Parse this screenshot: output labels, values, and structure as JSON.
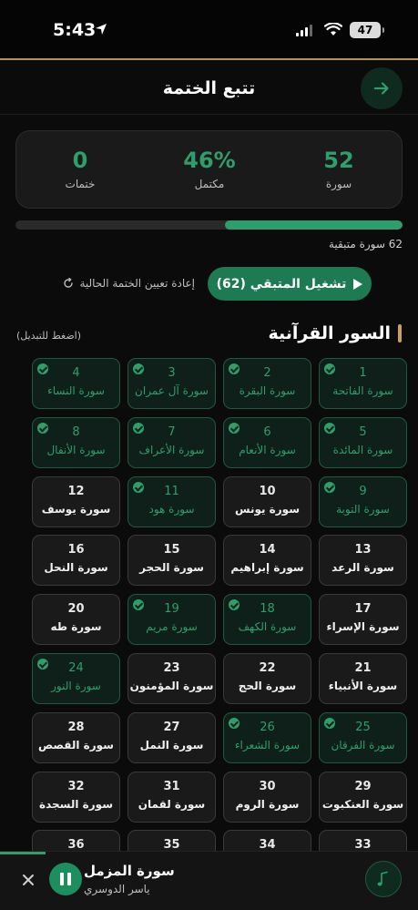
{
  "status_bar": {
    "time": "5:43",
    "battery": "47"
  },
  "header": {
    "title": "تتبع الختمة"
  },
  "stats": [
    {
      "value": "52",
      "label": "سورة"
    },
    {
      "value": "46%",
      "label": "مكتمل"
    },
    {
      "value": "0",
      "label": "ختمات"
    }
  ],
  "progress": {
    "fraction": 0.46,
    "remaining_text": "62 سورة متبقية"
  },
  "actions": {
    "play_label": "تشغيل المتبقي (62)",
    "reset_label": "إعادة تعيين الختمة الحالية"
  },
  "section": {
    "title": "السور القرآنية",
    "hint": "(اضغط للتبديل)"
  },
  "surahs": [
    {
      "num": "1",
      "name": "سورة الفاتحة",
      "done": true
    },
    {
      "num": "2",
      "name": "سورة البقرة",
      "done": true
    },
    {
      "num": "3",
      "name": "سورة آل عمران",
      "done": true
    },
    {
      "num": "4",
      "name": "سورة النساء",
      "done": true
    },
    {
      "num": "5",
      "name": "سورة المائدة",
      "done": true
    },
    {
      "num": "6",
      "name": "سورة الأنعام",
      "done": true
    },
    {
      "num": "7",
      "name": "سورة الأعراف",
      "done": true
    },
    {
      "num": "8",
      "name": "سورة الأنفال",
      "done": true
    },
    {
      "num": "9",
      "name": "سورة التوبة",
      "done": true
    },
    {
      "num": "10",
      "name": "سورة يونس",
      "done": false
    },
    {
      "num": "11",
      "name": "سورة هود",
      "done": true
    },
    {
      "num": "12",
      "name": "سورة يوسف",
      "done": false
    },
    {
      "num": "13",
      "name": "سورة الرعد",
      "done": false
    },
    {
      "num": "14",
      "name": "سورة إبراهيم",
      "done": false
    },
    {
      "num": "15",
      "name": "سورة الحجر",
      "done": false
    },
    {
      "num": "16",
      "name": "سورة النحل",
      "done": false
    },
    {
      "num": "17",
      "name": "سورة الإسراء",
      "done": false
    },
    {
      "num": "18",
      "name": "سورة الكهف",
      "done": true
    },
    {
      "num": "19",
      "name": "سورة مريم",
      "done": true
    },
    {
      "num": "20",
      "name": "سورة طه",
      "done": false
    },
    {
      "num": "21",
      "name": "سورة الأنبياء",
      "done": false
    },
    {
      "num": "22",
      "name": "سورة الحج",
      "done": false
    },
    {
      "num": "23",
      "name": "سورة المؤمنون",
      "done": false
    },
    {
      "num": "24",
      "name": "سورة النور",
      "done": true
    },
    {
      "num": "25",
      "name": "سورة الفرقان",
      "done": true
    },
    {
      "num": "26",
      "name": "سورة الشعراء",
      "done": true
    },
    {
      "num": "27",
      "name": "سورة النمل",
      "done": false
    },
    {
      "num": "28",
      "name": "سورة القصص",
      "done": false
    },
    {
      "num": "29",
      "name": "سورة العنكبوت",
      "done": false
    },
    {
      "num": "30",
      "name": "سورة الروم",
      "done": false
    },
    {
      "num": "31",
      "name": "سورة لقمان",
      "done": false
    },
    {
      "num": "32",
      "name": "سورة السجدة",
      "done": false
    },
    {
      "num": "33",
      "name": "",
      "done": false
    },
    {
      "num": "34",
      "name": "",
      "done": false
    },
    {
      "num": "35",
      "name": "",
      "done": false
    },
    {
      "num": "36",
      "name": "",
      "done": false
    }
  ],
  "player": {
    "title": "سورة المزمل",
    "reciter": "ياسر الدوسري",
    "progress_fraction": 0.11
  },
  "colors": {
    "accent": "#2e9e6b",
    "gold": "#b89556",
    "background": "#0b0b0b"
  }
}
